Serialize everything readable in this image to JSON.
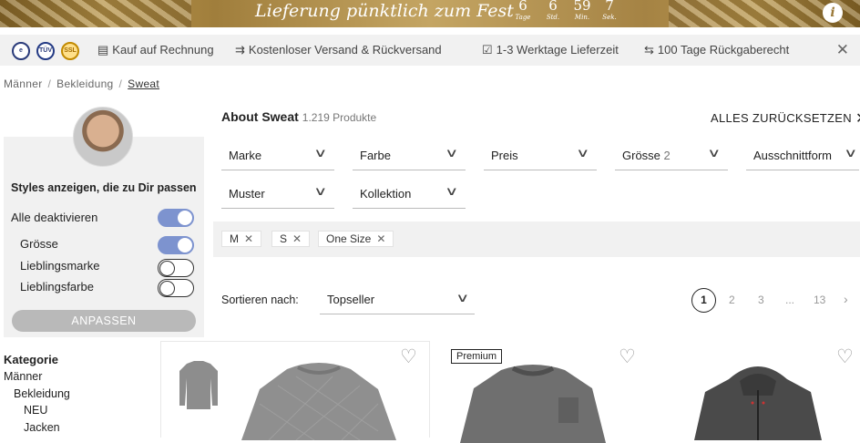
{
  "banner": {
    "title": "Lieferung pünktlich zum Fest",
    "countdown": [
      {
        "value": "6",
        "unit": "Tage"
      },
      {
        "value": "6",
        "unit": "Std."
      },
      {
        "value": "59",
        "unit": "Min."
      },
      {
        "value": "7",
        "unit": "Sek."
      }
    ],
    "info_icon": "info-icon"
  },
  "usp_bar": {
    "badges": [
      "e",
      "TÜV",
      "SSL"
    ],
    "items": [
      {
        "icon": "invoice-icon",
        "label": "Kauf auf Rechnung"
      },
      {
        "icon": "truck-icon",
        "label": "Kostenloser Versand & Rückversand"
      },
      {
        "icon": "checkbox-icon",
        "label": "1-3 Werktage Lieferzeit"
      },
      {
        "icon": "exchange-icon",
        "label": "100 Tage Rückgaberecht"
      }
    ]
  },
  "breadcrumb": [
    "Männer",
    "Bekleidung",
    "Sweat"
  ],
  "sidebar": {
    "styles_title": "Styles anzeigen, die zu Dir passen",
    "toggles": [
      {
        "label": "Alle deaktivieren",
        "on": true
      },
      {
        "label": "Grösse",
        "on": true
      },
      {
        "label": "Lieblingsmarke",
        "on": false
      },
      {
        "label": "Lieblingsfarbe",
        "on": false
      }
    ],
    "apply_label": "ANPASSEN",
    "category_title": "Kategorie",
    "categories": [
      "Männer",
      "Bekleidung",
      "NEU",
      "Jacken"
    ]
  },
  "main": {
    "title": "About Sweat",
    "count": "1.219 Produkte",
    "reset_label": "ALLES ZURÜCKSETZEN",
    "filters": [
      {
        "label": "Marke",
        "count": ""
      },
      {
        "label": "Farbe",
        "count": ""
      },
      {
        "label": "Preis",
        "count": ""
      },
      {
        "label": "Grösse",
        "count": "2"
      },
      {
        "label": "Ausschnittform",
        "count": ""
      },
      {
        "label": "Muster",
        "count": ""
      },
      {
        "label": "Kollektion",
        "count": ""
      }
    ],
    "active_chips": [
      "M",
      "S",
      "One Size"
    ],
    "sort_label": "Sortieren nach:",
    "sort_value": "Topseller",
    "pagination": [
      "1",
      "2",
      "3",
      "...",
      "13"
    ],
    "premium_badge": "Premium"
  },
  "colors": {
    "toggle_on": "#7d93cf",
    "banner_gold": "#b8954a",
    "panel_gray": "#f1f1f1"
  }
}
